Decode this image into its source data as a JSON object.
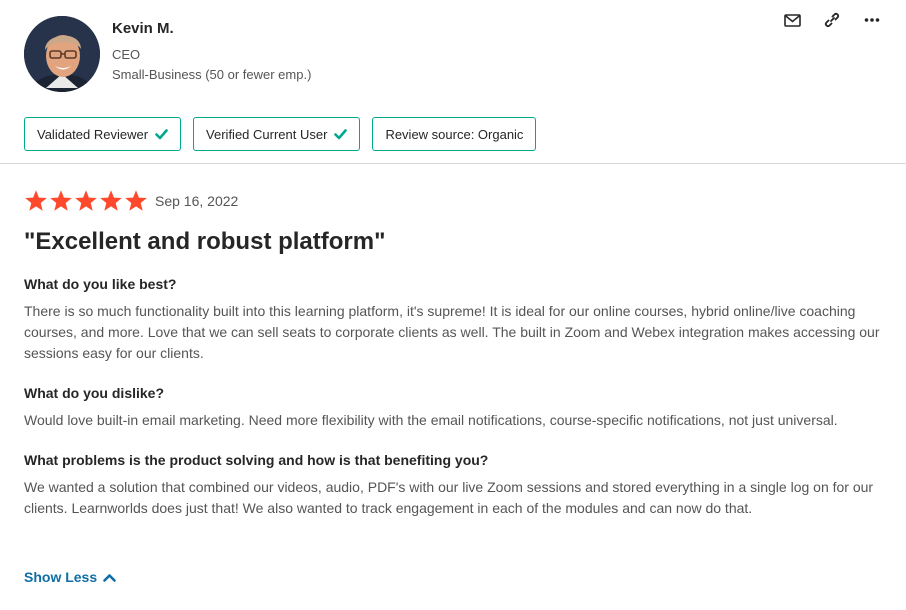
{
  "reviewer": {
    "name": "Kevin M.",
    "title": "CEO",
    "segment": "Small-Business (50 or fewer emp.)"
  },
  "actions": {
    "icons": [
      "mail-icon",
      "link-icon",
      "more-icon"
    ]
  },
  "badges": [
    {
      "label": "Validated Reviewer",
      "icon": "check-icon"
    },
    {
      "label": "Verified Current User",
      "icon": "check-icon"
    },
    {
      "label": "Review source: Organic"
    }
  ],
  "review": {
    "rating": 5,
    "rating_max": 5,
    "date": "Sep 16, 2022",
    "title": "\"Excellent and robust platform\"",
    "qa": [
      {
        "question": "What do you like best?",
        "answer": "There is so much functionality built into this learning platform, it's supreme! It is ideal for our online courses, hybrid online/live coaching courses, and more. Love that we can sell seats to corporate clients as well. The built in Zoom and Webex integration makes accessing our sessions easy for our clients."
      },
      {
        "question": "What do you dislike?",
        "answer": "Would love built-in email marketing. Need more flexibility with the email notifications, course-specific notifications, not just universal."
      },
      {
        "question": "What problems is the product solving and how is that benefiting you?",
        "answer": "We wanted a solution that combined our videos, audio, PDF's with our live Zoom sessions and stored everything in a single log on for our clients. Learnworlds does just that! We also wanted to track engagement in each of the modules and can now do that."
      }
    ],
    "show_less_label": "Show Less"
  },
  "colors": {
    "star": "#ff492c",
    "badge_border": "#00a88e",
    "check": "#00a88e",
    "link": "#0f6ea7",
    "divider": "#d8d8d8"
  }
}
